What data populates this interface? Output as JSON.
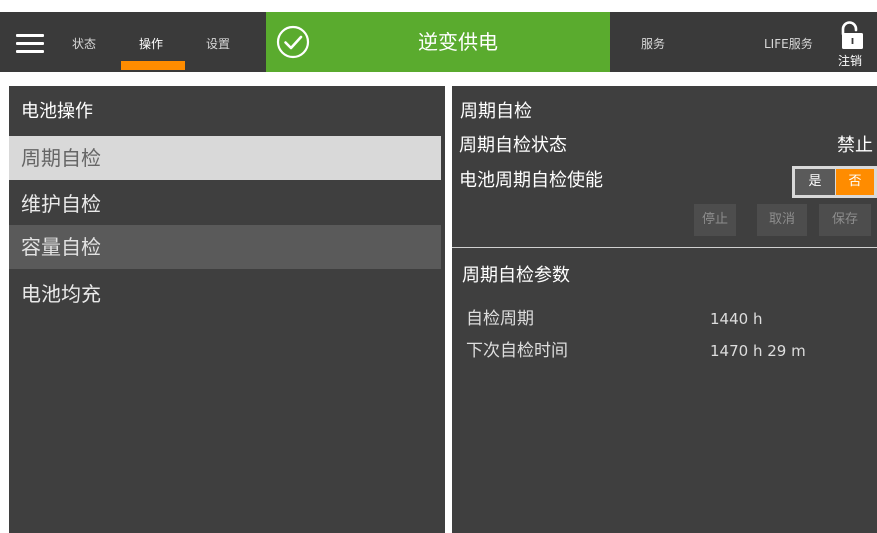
{
  "header": {
    "tabs": [
      {
        "label": "状态",
        "active": false
      },
      {
        "label": "操作",
        "active": true
      },
      {
        "label": "设置",
        "active": false
      }
    ],
    "status_text": "逆变供电",
    "status_color": "#5aab2e",
    "right_links": [
      {
        "label": "服务"
      },
      {
        "label": "LIFE服务"
      }
    ],
    "logout_label": "注销",
    "accent_color": "#ff8c00"
  },
  "left_panel": {
    "title": "电池操作",
    "items": [
      {
        "label": "周期自检",
        "state": "selected"
      },
      {
        "label": "维护自检",
        "state": "normal"
      },
      {
        "label": "容量自检",
        "state": "hover"
      },
      {
        "label": "电池均充",
        "state": "normal"
      }
    ]
  },
  "right_panel": {
    "title": "周期自检",
    "status_row": {
      "label": "周期自检状态",
      "value": "禁止"
    },
    "enable_row": {
      "label": "电池周期自检使能",
      "yes_label": "是",
      "no_label": "否",
      "selected": "否"
    },
    "buttons": [
      {
        "label": "停止"
      },
      {
        "label": "取消"
      },
      {
        "label": "保存"
      }
    ],
    "params_title": "周期自检参数",
    "params": [
      {
        "label": "自检周期",
        "value": "1440 h"
      },
      {
        "label": "下次自检时间",
        "value": "1470 h 29 m"
      }
    ]
  }
}
